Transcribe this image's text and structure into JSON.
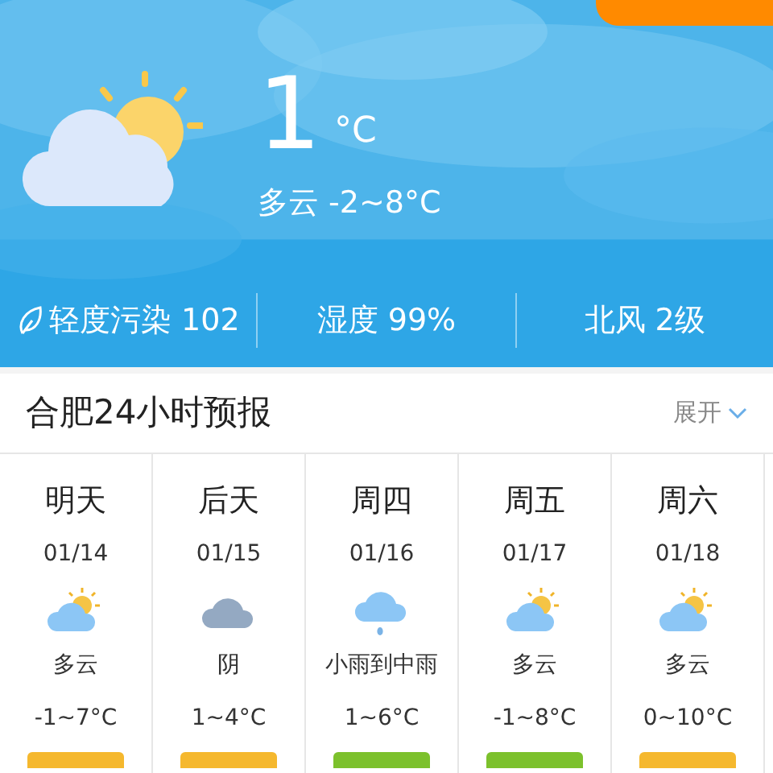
{
  "current": {
    "temperature": "1",
    "unit": "°C",
    "summary": "多云 -2~8°C"
  },
  "stats": [
    {
      "kind": "air",
      "text": "轻度污染 102"
    },
    {
      "kind": "plain",
      "text": "湿度 99%"
    },
    {
      "kind": "plain",
      "text": "北风 2级"
    }
  ],
  "forecast": {
    "title": "合肥24小时预报",
    "toggle": "展开",
    "days": [
      {
        "day": "明天",
        "date": "01/14",
        "kind": "partly-cloudy",
        "condition": "多云",
        "temp": "-1~7°C",
        "color": "#f5b82e"
      },
      {
        "day": "后天",
        "date": "01/15",
        "kind": "overcast",
        "condition": "阴",
        "temp": "1~4°C",
        "color": "#f5b82e"
      },
      {
        "day": "周四",
        "date": "01/16",
        "kind": "rain",
        "condition": "小雨到中雨",
        "temp": "1~6°C",
        "color": "#7cc12c"
      },
      {
        "day": "周五",
        "date": "01/17",
        "kind": "partly-cloudy",
        "condition": "多云",
        "temp": "-1~8°C",
        "color": "#7cc12c"
      },
      {
        "day": "周六",
        "date": "01/18",
        "kind": "partly-cloudy",
        "condition": "多云",
        "temp": "0~10°C",
        "color": "#f5b82e"
      }
    ]
  }
}
